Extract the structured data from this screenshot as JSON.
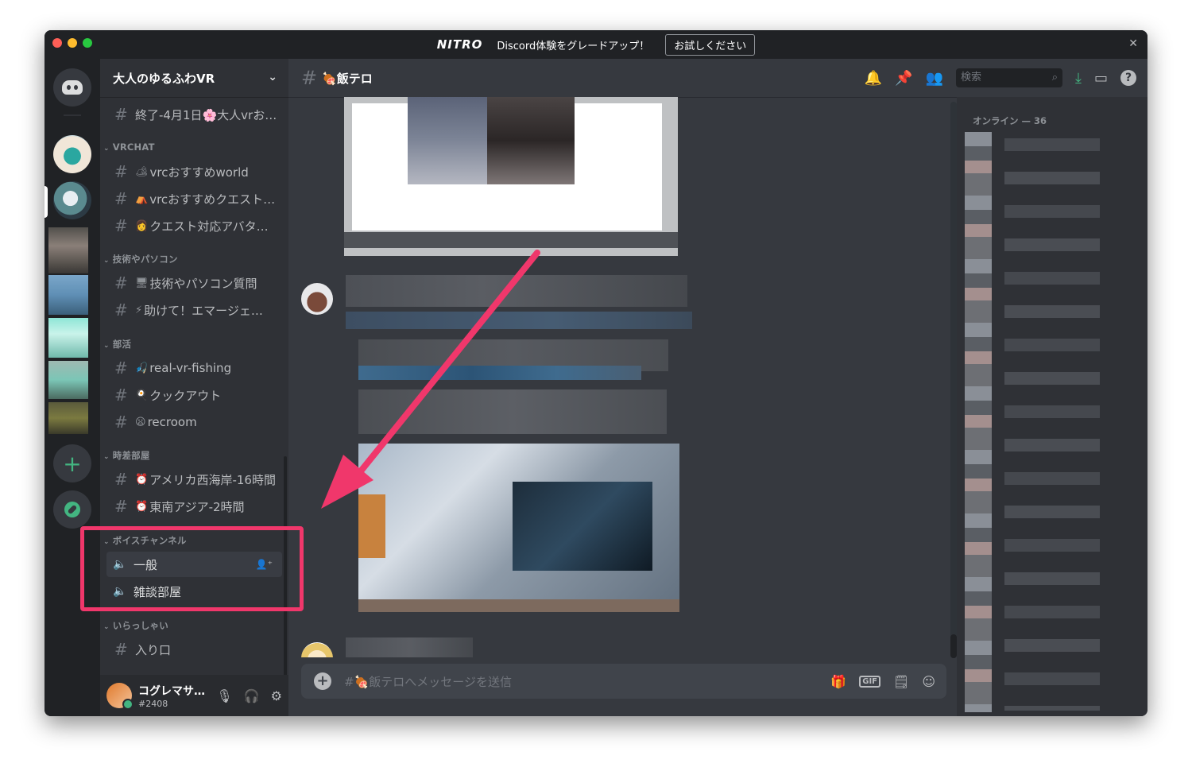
{
  "titlebar": {
    "nitro_logo": "NITRO",
    "promo_text": "Discord体験をグレードアップ！",
    "try_button": "お試しください",
    "close": "✕"
  },
  "server": {
    "name": "大人のゆるふわVR"
  },
  "channels": {
    "top": [
      {
        "emoji": "",
        "label": "終了-4月1日🌸大人vrお…"
      }
    ],
    "categories": [
      {
        "name": "VRCHAT",
        "items": [
          {
            "emoji": "🏕",
            "label": "vrcおすすめworld"
          },
          {
            "emoji": "⛺",
            "label": "vrcおすすめクエスト…"
          },
          {
            "emoji": "👩",
            "label": "クエスト対応アバタ…"
          }
        ]
      },
      {
        "name": "技術やパソコン",
        "items": [
          {
            "emoji": "🖥",
            "label": "技術やパソコン質問"
          },
          {
            "emoji": "⚡",
            "label": "助けて！エマージェ…"
          }
        ]
      },
      {
        "name": "部活",
        "items": [
          {
            "emoji": "🎣",
            "label": "real-vr-fishing"
          },
          {
            "emoji": "🍳",
            "label": "クックアウト"
          },
          {
            "emoji": "😦",
            "label": "recroom"
          }
        ]
      },
      {
        "name": "時差部屋",
        "items": [
          {
            "emoji": "⏰",
            "label": "アメリカ西海岸-16時間"
          },
          {
            "emoji": "⏰",
            "label": "東南アジア-2時間"
          }
        ]
      }
    ],
    "voice_category": "ボイスチャンネル",
    "voice": [
      {
        "label": "一般"
      },
      {
        "label": "雑談部屋"
      }
    ],
    "welcome_category": "いらっしゃい",
    "welcome": [
      {
        "label": "入り口"
      }
    ]
  },
  "user": {
    "name": "コグレマサ…",
    "tag": "#2408"
  },
  "chat": {
    "channel_name": "🍖飯テロ",
    "search_placeholder": "検索",
    "composer_placeholder": "#🍖飯テロへメッセージを送信",
    "gif_label": "GIF"
  },
  "members": {
    "header": "オンライン — 36"
  },
  "colors": {
    "accent_highlight": "#f0376b",
    "online": "#43b581",
    "bg_chat": "#36393f",
    "bg_sidebar": "#2f3136",
    "bg_rail": "#202225"
  }
}
